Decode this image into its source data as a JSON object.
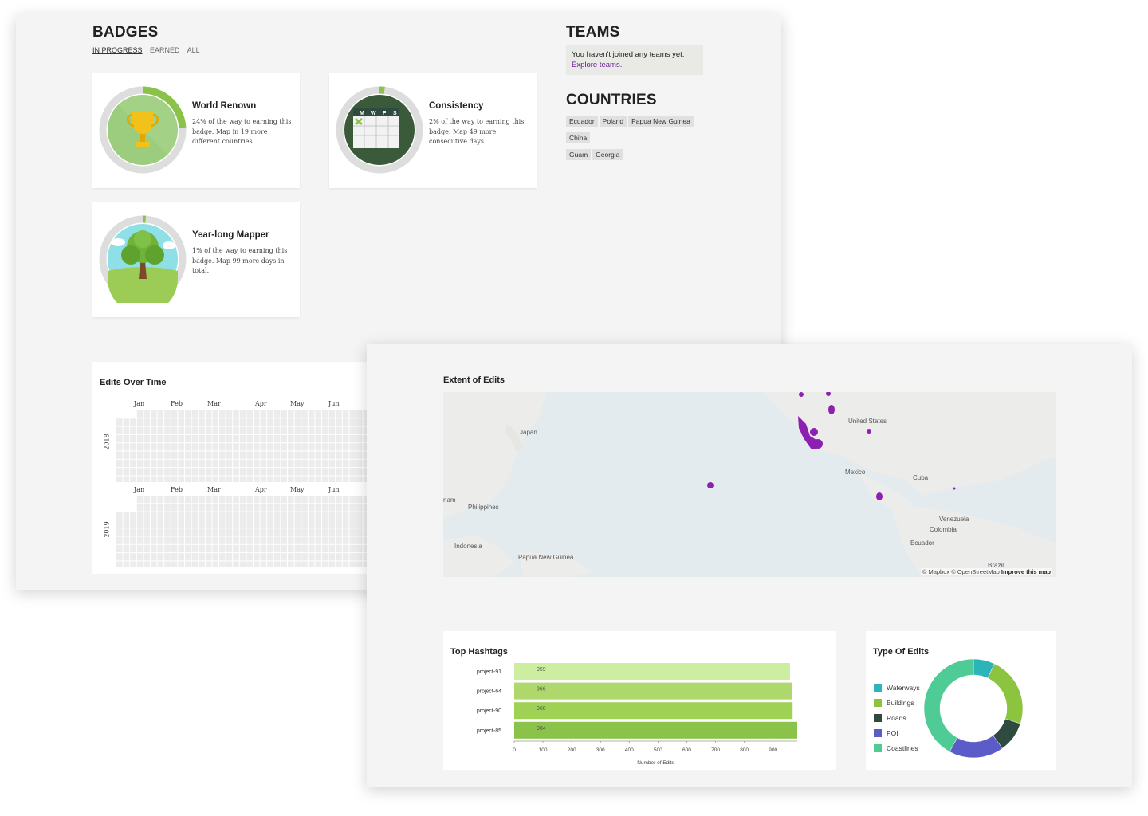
{
  "badges": {
    "title": "BADGES",
    "tabs": [
      "IN PROGRESS",
      "EARNED",
      "ALL"
    ],
    "items": [
      {
        "name": "World Renown",
        "desc": "24% of the way to earning this badge. Map in 19 more different countries.",
        "progress": 0.24
      },
      {
        "name": "Consistency",
        "desc": "2% of the way to earning this badge. Map 49 more consecutive days.",
        "progress": 0.02
      },
      {
        "name": "Year-long Mapper",
        "desc": "1% of the way to earning this badge. Map 99 more days in total.",
        "progress": 0.01
      }
    ],
    "calendar_days": [
      "M",
      "W",
      "F",
      "S"
    ]
  },
  "teams": {
    "title": "TEAMS",
    "message": "You haven't joined any teams yet.",
    "link": "Explore teams."
  },
  "countries": {
    "title": "COUNTRIES",
    "items": [
      "Ecuador",
      "Poland",
      "Papua New Guinea",
      "China",
      "Guam",
      "Georgia"
    ]
  },
  "edits_over_time": {
    "title": "Edits Over Time",
    "months": [
      "Jan",
      "Feb",
      "Mar",
      "Apr",
      "May",
      "Jun"
    ],
    "years": [
      "2018",
      "2019"
    ]
  },
  "map": {
    "title": "Extent of Edits",
    "labels": [
      "Japan",
      "United States",
      "Mexico",
      "Cuba",
      "nam",
      "Philippines",
      "Venezuela",
      "Colombia",
      "Ecuador",
      "Indonesia",
      "Papua New Guinea",
      "Brazil"
    ],
    "attribution": "© Mapbox © OpenStreetMap",
    "improve": "Improve this map"
  },
  "chart_data": [
    {
      "type": "bar",
      "title": "Top Hashtags",
      "categories": [
        "project-91",
        "project-64",
        "project-90",
        "project-85"
      ],
      "values": [
        959,
        966,
        968,
        984
      ],
      "xlabel": "Number of Edits",
      "xlim": [
        0,
        984
      ],
      "ticks": [
        0,
        100,
        200,
        300,
        400,
        500,
        600,
        700,
        800,
        900
      ],
      "colors": [
        "#cdeea0",
        "#aed86b",
        "#9fd154",
        "#8bc34a"
      ]
    },
    {
      "type": "pie",
      "title": "Type Of Edits",
      "categories": [
        "Waterways",
        "Buildings",
        "Roads",
        "POI",
        "Coastlines"
      ],
      "values": [
        7,
        23,
        10,
        18,
        42
      ],
      "colors": [
        "#2bb5b9",
        "#8cc43f",
        "#2f4a3f",
        "#5b5cc7",
        "#4fcb95"
      ]
    }
  ],
  "colors": {
    "accent": "#8bc34a",
    "ring": "#dddddd",
    "link": "#6a1b9a",
    "map_point": "#8e1fb3"
  }
}
